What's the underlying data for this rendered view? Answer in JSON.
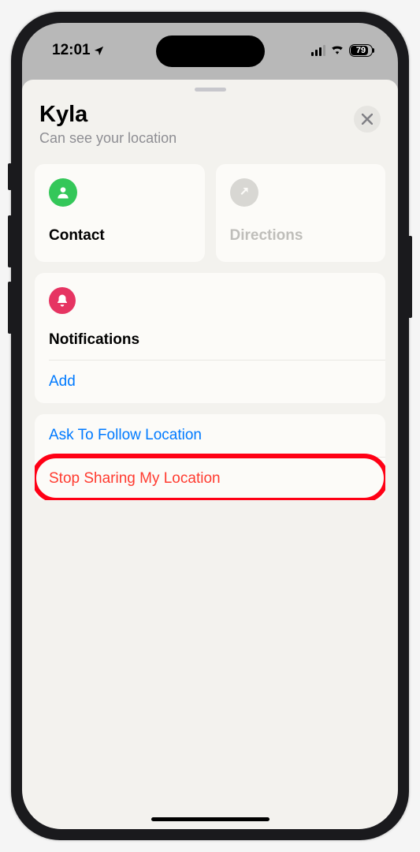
{
  "status": {
    "time": "12:01",
    "battery_pct": "79"
  },
  "header": {
    "title": "Kyla",
    "subtitle": "Can see your location"
  },
  "cards": {
    "contact": {
      "label": "Contact"
    },
    "directions": {
      "label": "Directions"
    }
  },
  "notifications": {
    "title": "Notifications",
    "add_label": "Add"
  },
  "actions": {
    "ask_follow": "Ask To Follow Location",
    "stop_sharing": "Stop Sharing My Location"
  }
}
